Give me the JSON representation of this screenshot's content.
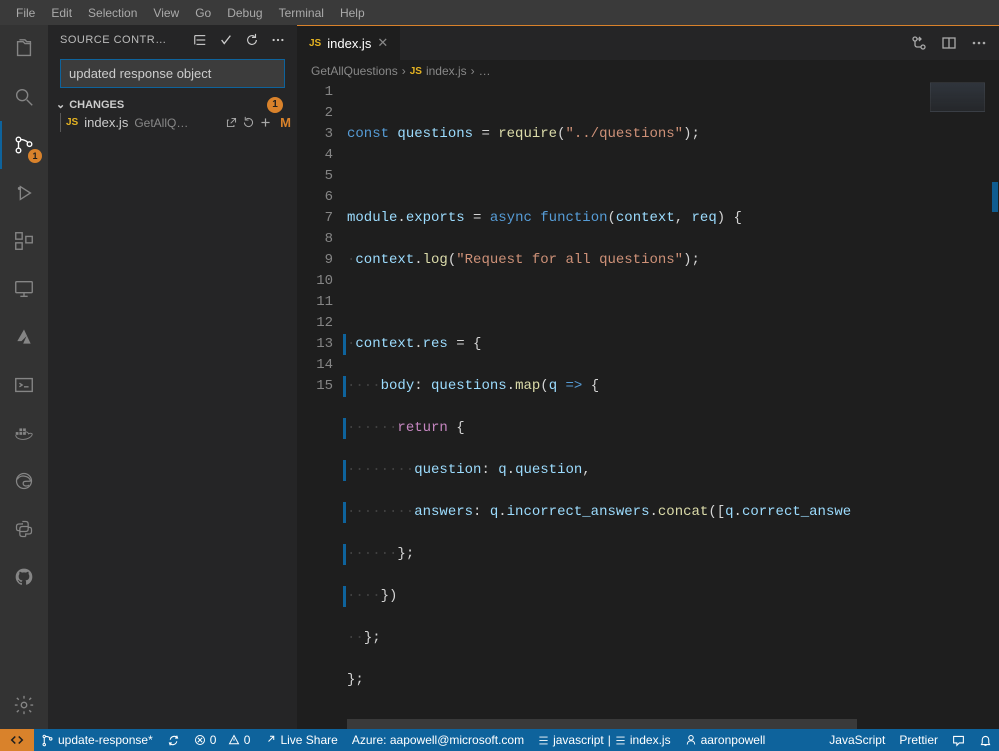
{
  "menu": [
    "File",
    "Edit",
    "Selection",
    "View",
    "Go",
    "Debug",
    "Terminal",
    "Help"
  ],
  "activity": {
    "scm_badge": "1"
  },
  "panel": {
    "title": "SOURCE CONTR…",
    "commit_msg": "updated response object",
    "changes_label": "CHANGES",
    "changes_count": "1",
    "file": {
      "lang": "JS",
      "name": "index.js",
      "dir": "GetAllQ…",
      "status": "M"
    }
  },
  "tab": {
    "lang": "JS",
    "title": "index.js"
  },
  "breadcrumb": {
    "folder": "GetAllQuestions",
    "lang": "JS",
    "file": "index.js",
    "tail": "…"
  },
  "code": {
    "line_count": 15,
    "l1": {
      "a": "const",
      "b": " questions ",
      "c": "=",
      "d": " ",
      "e": "require",
      "f": "(",
      "g": "\"../questions\"",
      "h": ");"
    },
    "l3": {
      "a": "module",
      "b": ".",
      "c": "exports",
      "d": " ",
      "e": "=",
      "f": " ",
      "g": "async",
      "h": " ",
      "i": "function",
      "j": "(",
      "k": "context",
      "l": ", ",
      "m": "req",
      "n": ") {"
    },
    "l4": {
      "pad": "·",
      "a": "context",
      "b": ".",
      "c": "log",
      "d": "(",
      "e": "\"Request for all questions\"",
      "f": ");"
    },
    "l6": {
      "pad": "·",
      "a": "context",
      "b": ".",
      "c": "res",
      "d": " ",
      "e": "=",
      "f": " {"
    },
    "l7": {
      "pad": "····",
      "a": "body",
      "b": ": ",
      "c": "questions",
      "d": ".",
      "e": "map",
      "f": "(",
      "g": "q",
      "h": " ",
      "i": "=>",
      "j": " {"
    },
    "l8": {
      "pad": "······",
      "a": "return",
      "b": " {"
    },
    "l9": {
      "pad": "········",
      "a": "question",
      "b": ": ",
      "c": "q",
      "d": ".",
      "e": "question",
      "f": ","
    },
    "l10": {
      "pad": "········",
      "a": "answers",
      "b": ": ",
      "c": "q",
      "d": ".",
      "e": "incorrect_answers",
      "f": ".",
      "g": "concat",
      "h": "([",
      "i": "q",
      "j": ".",
      "k": "correct_answe"
    },
    "l11": {
      "pad": "······",
      "a": "};"
    },
    "l12": {
      "pad": "····",
      "a": "})"
    },
    "l13": {
      "pad": "··",
      "a": "};"
    },
    "l14": {
      "a": "};"
    }
  },
  "status": {
    "branch": "update-response*",
    "errors": "0",
    "warnings": "0",
    "liveshare": "Live Share",
    "azure": "Azure: aapowell@microsoft.com",
    "spaces_l": "javascript",
    "spaces_r": "index.js",
    "user": "aaronpowell",
    "lang": "JavaScript",
    "prettier": "Prettier"
  }
}
